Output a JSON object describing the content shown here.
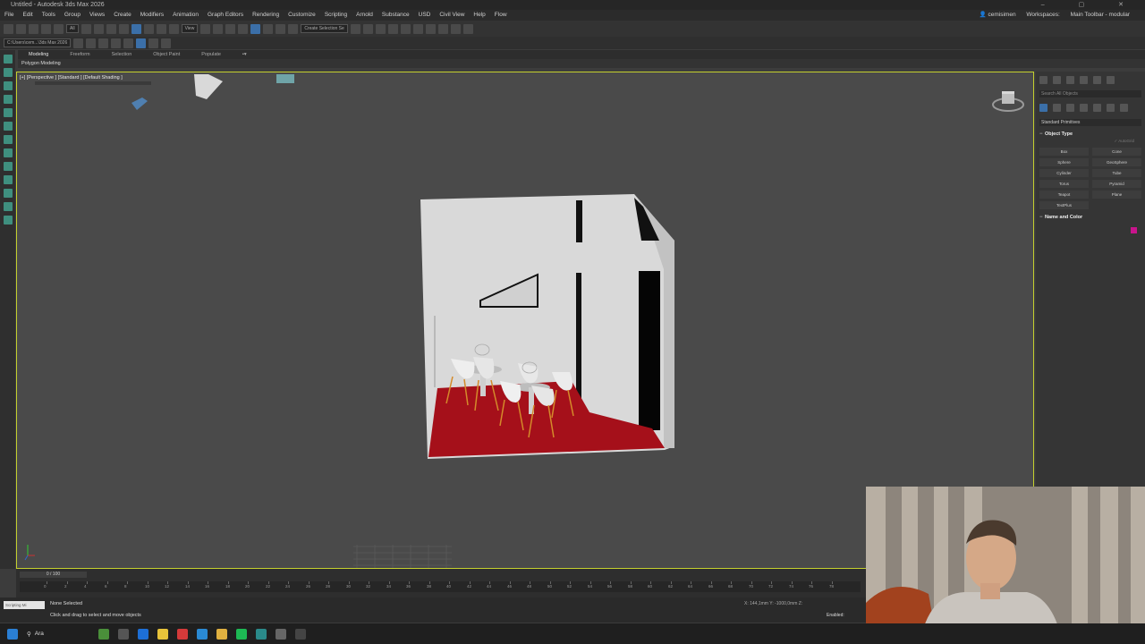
{
  "window": {
    "title": "Untitled - Autodesk 3ds Max 2026",
    "controls": "– ▢ ✕"
  },
  "menu": {
    "items": [
      "File",
      "Edit",
      "Tools",
      "Group",
      "Views",
      "Create",
      "Modifiers",
      "Animation",
      "Graph Editors",
      "Rendering",
      "Customize",
      "Scripting",
      "Arnold",
      "Substance",
      "USD",
      "Civil View",
      "Help",
      "Flow"
    ],
    "user": "cemisimen",
    "workspaces_label": "Workspaces:",
    "workspace_value": "Main Toolbar - modular"
  },
  "toolbar": {
    "selection_filter": "All",
    "ref_coord": "View",
    "named_selection": "Create Selection Se"
  },
  "toolbar2": {
    "project_path": "C:\\Users\\cem...\\3ds Max 2026"
  },
  "ribbon": {
    "tabs": [
      "Modeling",
      "Freeform",
      "Selection",
      "Object Paint",
      "Populate"
    ],
    "active_tab": "Modeling",
    "sub_label": "Polygon Modeling"
  },
  "viewport": {
    "label": "[+] [Perspective ] [Standard ] [Default Shading ]"
  },
  "command_panel": {
    "search_placeholder": "Search All Objects",
    "category": "Standard Primitives",
    "object_type_title": "Object Type",
    "autogrid": "✓ AutoGrid",
    "buttons": [
      "Box",
      "Cone",
      "Sphere",
      "GeoSphere",
      "Cylinder",
      "Tube",
      "Torus",
      "Pyramid",
      "Teapot",
      "Plane",
      "TextPlus"
    ],
    "name_color_title": "Name and Color",
    "color": "#c8148c"
  },
  "timeline": {
    "frame_slider": "0 / 100",
    "ticks": [
      "0",
      "2",
      "4",
      "6",
      "8",
      "10",
      "12",
      "14",
      "16",
      "18",
      "20",
      "22",
      "24",
      "26",
      "28",
      "30",
      "32",
      "34",
      "36",
      "38",
      "40",
      "42",
      "44",
      "46",
      "48",
      "50",
      "52",
      "54",
      "56",
      "58",
      "60",
      "62",
      "64",
      "66",
      "68",
      "70",
      "72",
      "74",
      "76",
      "78"
    ]
  },
  "status": {
    "maxscript": "Scripting Mi",
    "line1": "None Selected",
    "line2": "Click and drag to select and move objects",
    "coords": "X: 144,1mm    Y: -1000,0mm    Z:",
    "enabled": "Enabled:"
  },
  "taskbar": {
    "search_label": "Ara"
  },
  "colors": {
    "floor": "#a5101a",
    "walls": "#d8d8d8",
    "viewport_border": "#c4d02e",
    "accent": "#3b6fa8"
  }
}
